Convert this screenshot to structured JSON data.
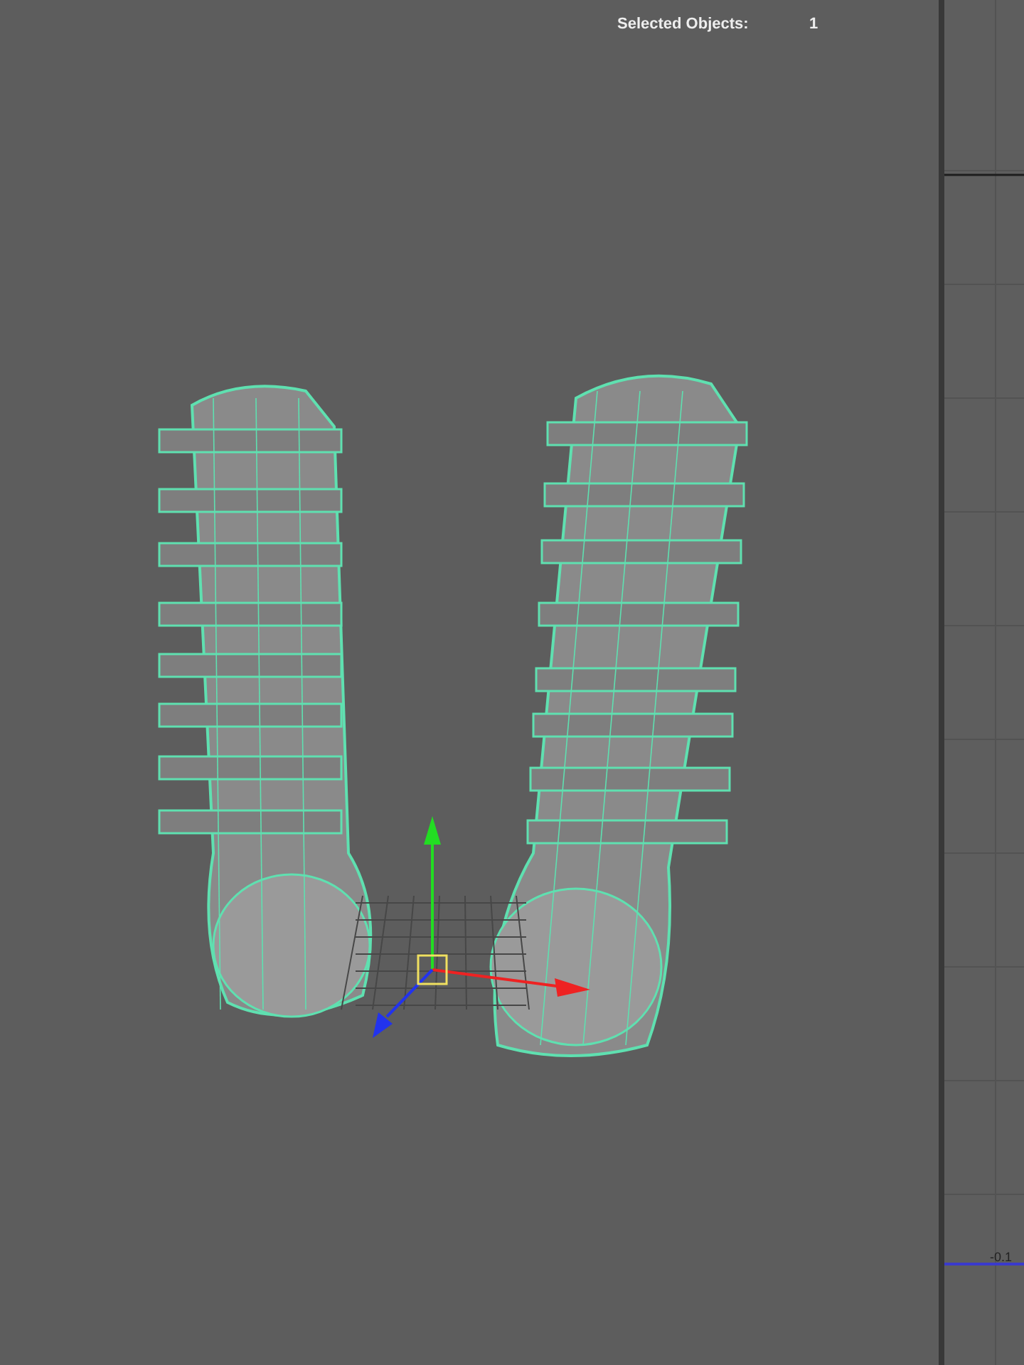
{
  "heads_up": [
    {
      "label": "Selected Objects:",
      "value": "1"
    }
  ],
  "graph_panel": {
    "value_label": "-0.1"
  }
}
